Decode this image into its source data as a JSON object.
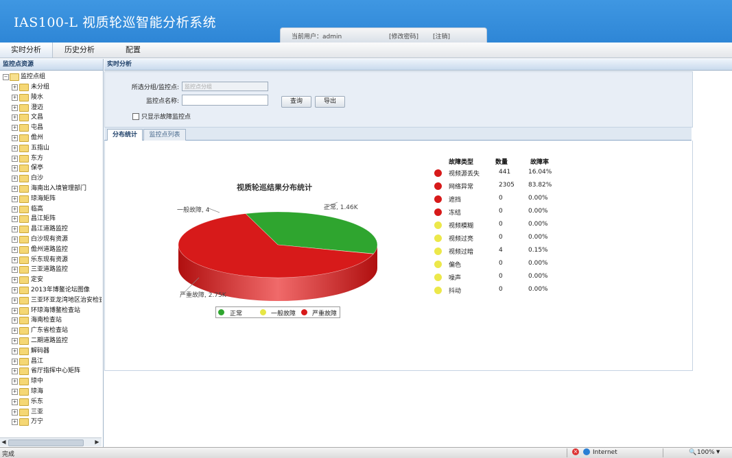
{
  "header": {
    "app_title": "IAS100-L  视质轮巡智能分析系统",
    "current_user": "当前用户：admin",
    "change_password": "[修改密码]",
    "logout": "[注销]"
  },
  "menu": [
    "实时分析",
    "历史分析",
    "配置"
  ],
  "left_panel": {
    "title": "监控点资源",
    "root": "监控点组",
    "items": [
      "未分组",
      "陵水",
      "澄迈",
      "文昌",
      "屯昌",
      "儋州",
      "五指山",
      "东方",
      "保亭",
      "白沙",
      "海南出入境管理部门",
      "琼海矩阵",
      "临高",
      "昌江矩阵",
      "昌江道路监控",
      "白沙现有资源",
      "儋州道路监控",
      "乐东现有资源",
      "三亚道路监控",
      "定安",
      "2013年博鳌论坛图像",
      "三亚环亚龙湾地区治安检查",
      "环琼海博鳌检查站",
      "海南检查站",
      "广东省检查站",
      "二期道路监控",
      "解码器",
      "昌江",
      "省厅指挥中心矩阵",
      "琼中",
      "琼海",
      "乐东",
      "三亚",
      "万宁"
    ]
  },
  "main": {
    "section_title": "实时分析",
    "group_label": "所选分组/监控点:",
    "group_value": "监控点分组",
    "name_label": "监控点名称:",
    "name_value": "",
    "query_button": "查询",
    "export_button": "导出",
    "only_fault_label": "只显示故障监控点",
    "only_fault_checked": false,
    "tabs": [
      "分布统计",
      "监控点列表"
    ]
  },
  "chart_data": {
    "type": "pie",
    "title": "视质轮巡结果分布统计",
    "slices": [
      {
        "name": "正常",
        "value": 1460,
        "label": "正常, 1.46K",
        "color": "#2fa52f"
      },
      {
        "name": "一般故障",
        "value": 4,
        "label": "一般故障, 4",
        "color": "#e6e645"
      },
      {
        "name": "严重故障",
        "value": 2750,
        "label": "严重故障, 2.75K",
        "color": "#d71a1a"
      }
    ],
    "legend": [
      "正常",
      "一般故障",
      "严重故障"
    ],
    "legend_position": "bottom"
  },
  "stats_table": {
    "headers": [
      "故障类型",
      "数量",
      "故障率"
    ],
    "rows": [
      {
        "type": "视频源丢失",
        "count": "441",
        "rate": "16.04%",
        "color": "#d71a1a"
      },
      {
        "type": "网络异常",
        "count": "2305",
        "rate": "83.82%",
        "color": "#d71a1a"
      },
      {
        "type": "遮挡",
        "count": "0",
        "rate": "0.00%",
        "color": "#d71a1a"
      },
      {
        "type": "冻结",
        "count": "0",
        "rate": "0.00%",
        "color": "#d71a1a"
      },
      {
        "type": "视频模糊",
        "count": "0",
        "rate": "0.00%",
        "color": "#ece84a"
      },
      {
        "type": "视频过亮",
        "count": "0",
        "rate": "0.00%",
        "color": "#ece84a"
      },
      {
        "type": "视频过暗",
        "count": "4",
        "rate": "0.15%",
        "color": "#ece84a"
      },
      {
        "type": "偏色",
        "count": "0",
        "rate": "0.00%",
        "color": "#ece84a"
      },
      {
        "type": "噪声",
        "count": "0",
        "rate": "0.00%",
        "color": "#ece84a"
      },
      {
        "type": "抖动",
        "count": "0",
        "rate": "0.00%",
        "color": "#ece84a"
      }
    ]
  },
  "status_bar": {
    "left": "完成",
    "zone": "Internet",
    "zoom": "100%"
  }
}
